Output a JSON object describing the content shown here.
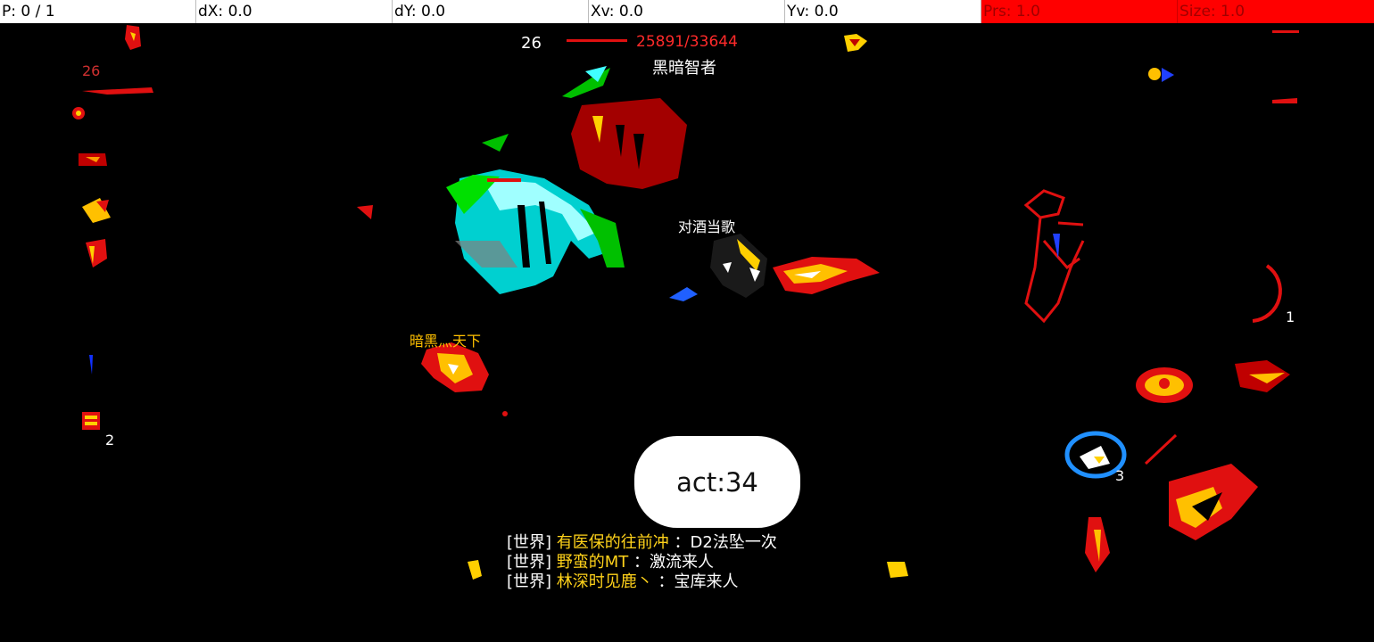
{
  "debug_bar": {
    "pointer": "P: 0 / 1",
    "dx": "dX: 0.0",
    "dy": "dY: 0.0",
    "xv": "Xv: 0.0",
    "yv": "Yv: 0.0",
    "prs": "Prs: 1.0",
    "size": "Size: 1.0"
  },
  "boss": {
    "level": "26",
    "hp": "25891/33644",
    "name": "黑暗智者",
    "hp_fraction": 0.77
  },
  "left_panel": {
    "level": "26",
    "item_count": "2"
  },
  "player": {
    "name": "对酒当歌"
  },
  "npc": {
    "name": "暗黑灬天下"
  },
  "skills": {
    "slot1": "1",
    "slot3": "3"
  },
  "act": {
    "label": "act:34"
  },
  "chat": [
    {
      "channel": "[世界]",
      "user": "有医保的往前冲",
      "message": "：D2法坠一次"
    },
    {
      "channel": "[世界]",
      "user": "野蛮的MT",
      "message": "：激流来人"
    },
    {
      "channel": "[世界]",
      "user": "林深时见鹿丶",
      "message": "：宝库来人"
    }
  ],
  "colors": {
    "alert_red": "#ff0000",
    "name_yellow": "#ffc000",
    "hp_red": "#ff2a2a"
  }
}
